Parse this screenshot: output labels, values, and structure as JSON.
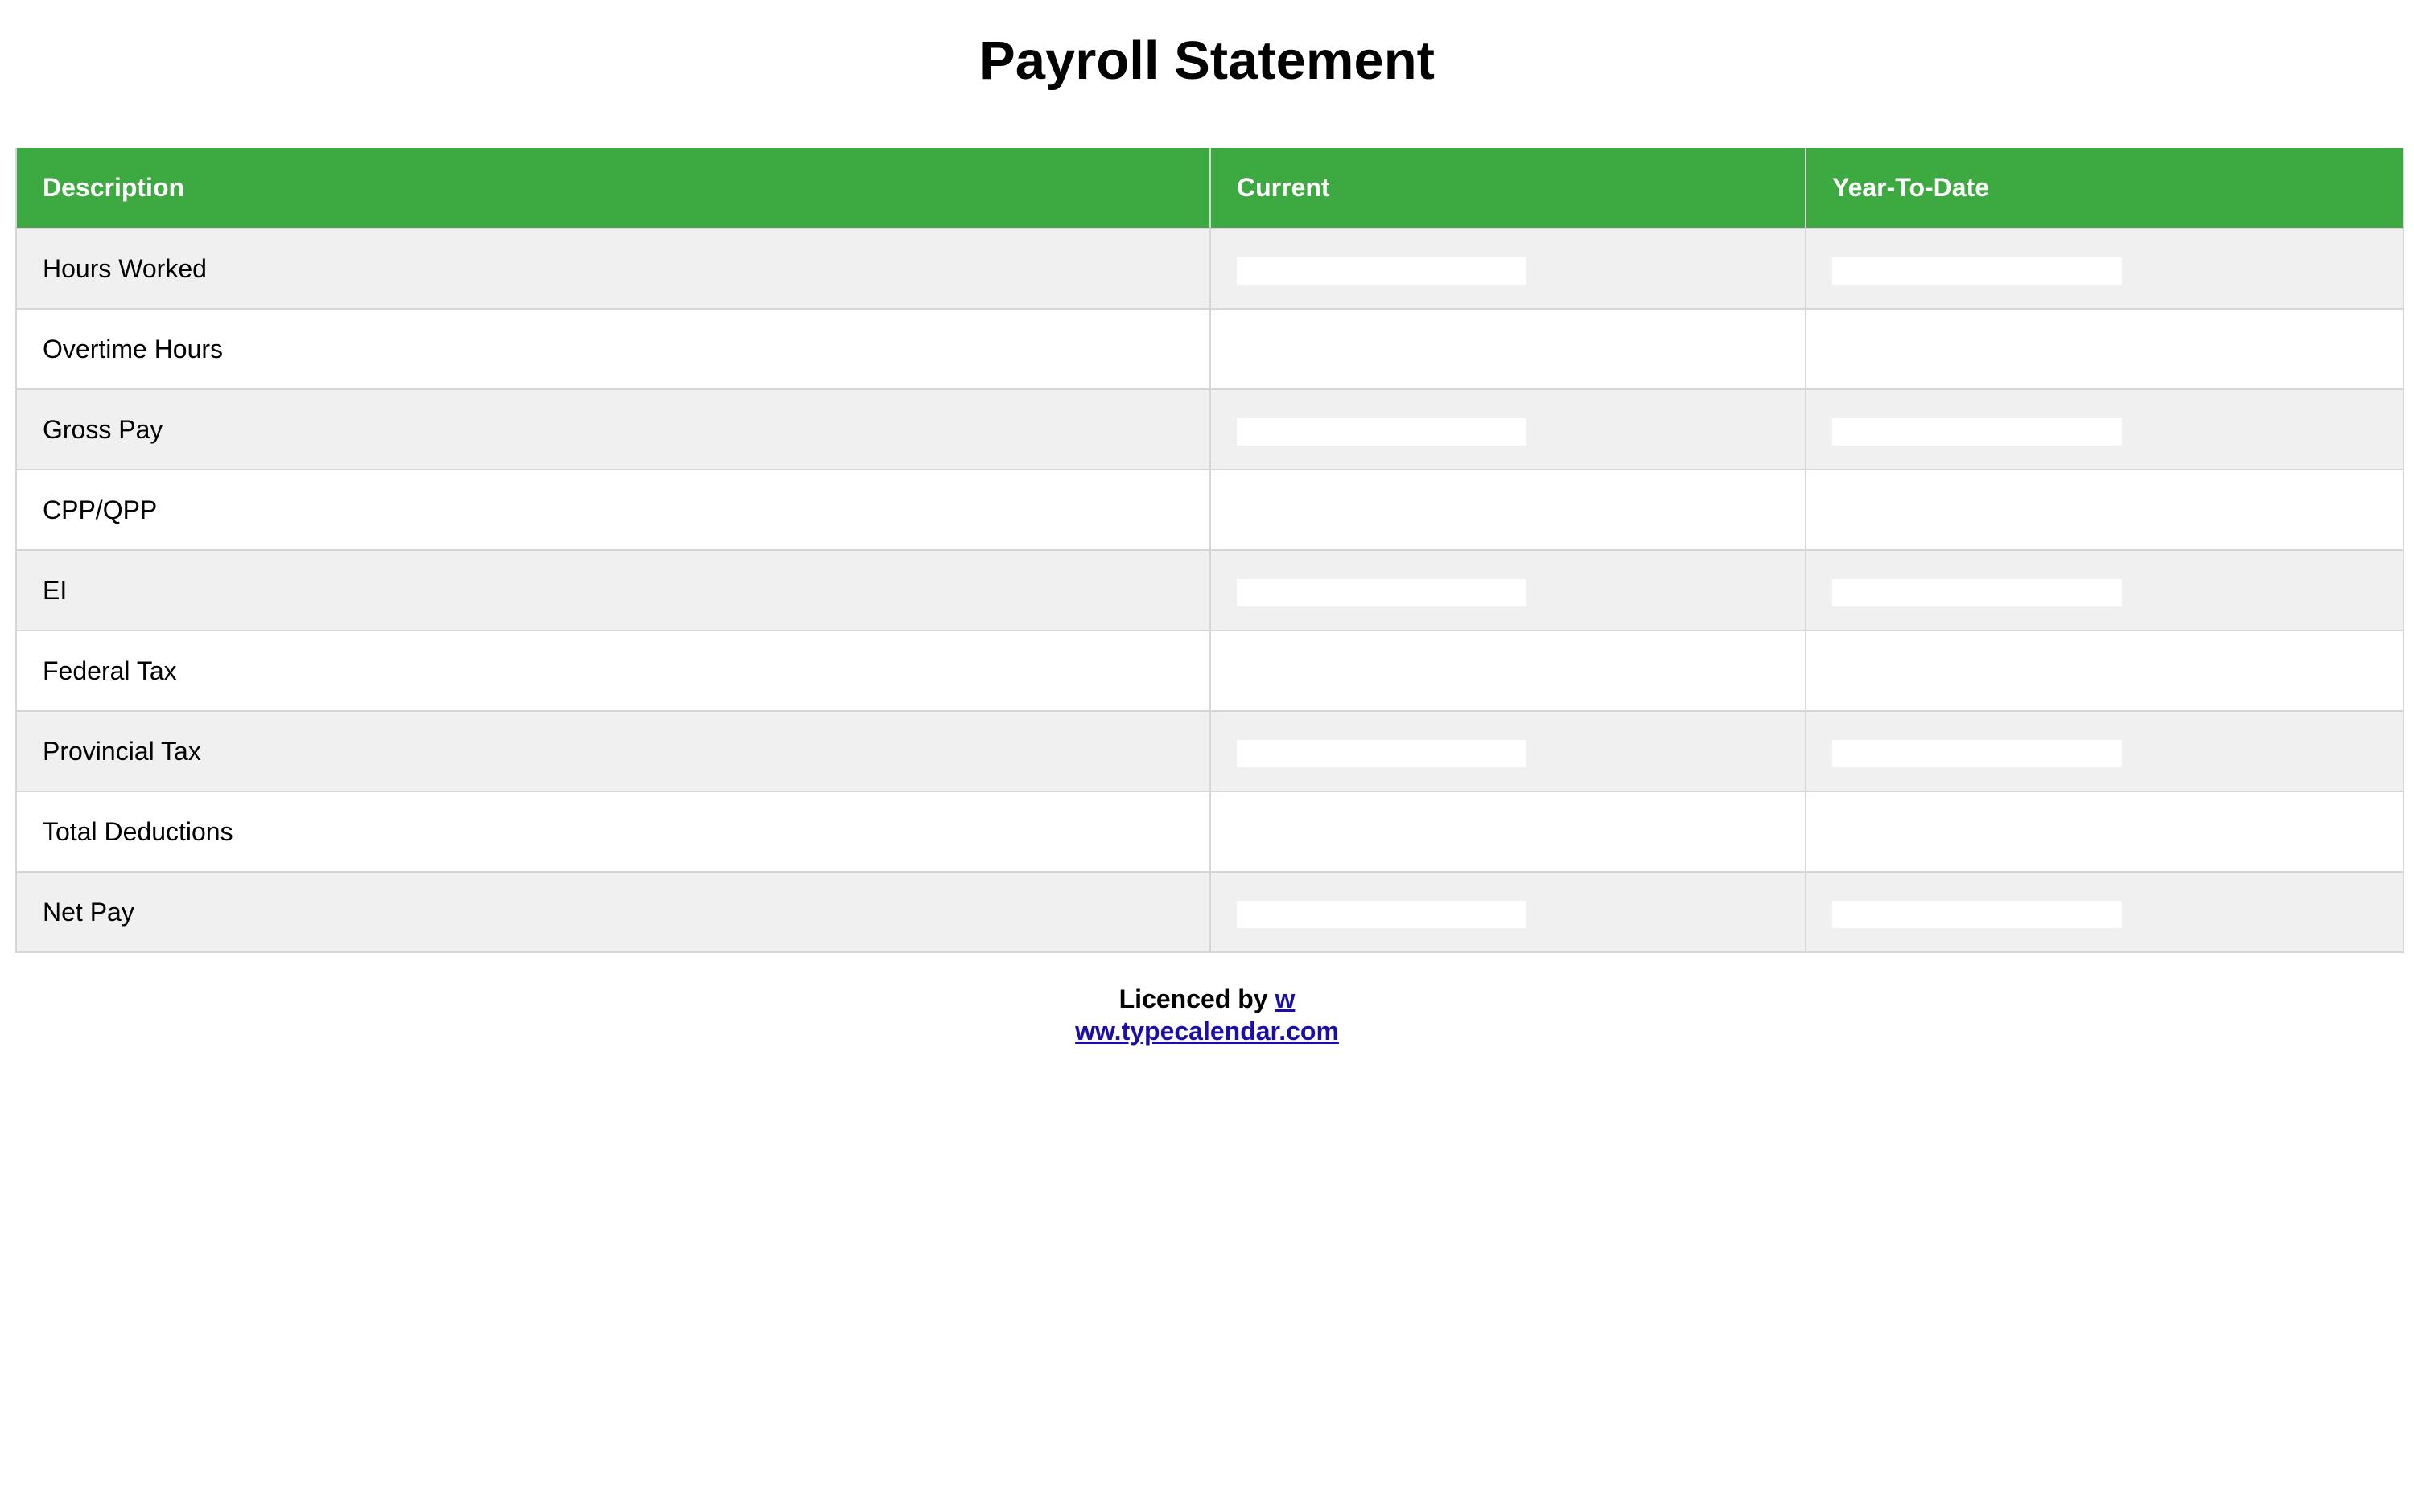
{
  "document": {
    "title": "Payroll Statement"
  },
  "table": {
    "headers": {
      "description": "Description",
      "current": "Current",
      "ytd": "Year-To-Date"
    },
    "header_color": "#3daa41",
    "stripe_color": "#f0f0f0",
    "rows": [
      {
        "description": "Hours Worked"
      },
      {
        "description": "Overtime Hours"
      },
      {
        "description": "Gross Pay"
      },
      {
        "description": "CPP/QPP"
      },
      {
        "description": "EI"
      },
      {
        "description": "Federal Tax"
      },
      {
        "description": "Provincial Tax"
      },
      {
        "description": "Total Deductions"
      },
      {
        "description": "Net Pay"
      }
    ]
  },
  "footer": {
    "prefix": "Licenced by ",
    "link_part1": "w",
    "link_part2": "ww.typecalendar.com",
    "link_color": "#1a0dab"
  }
}
